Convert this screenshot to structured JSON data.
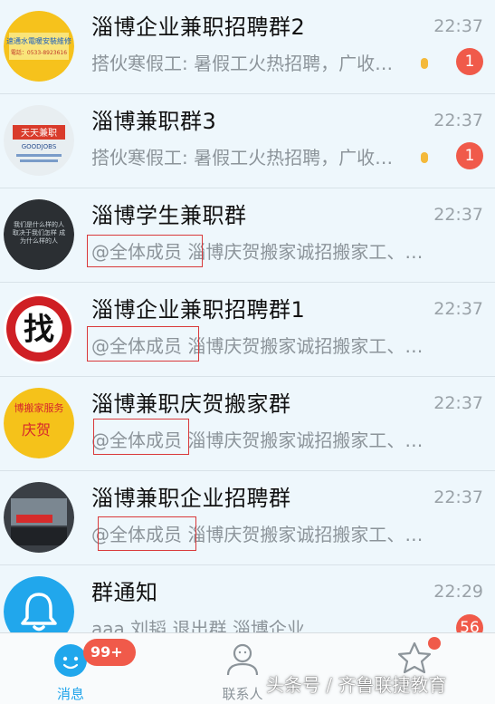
{
  "chats": [
    {
      "name": "淄博企业兼职招聘群2",
      "time": "22:37",
      "preview": "搭伙寒假工: 暑假工火热招聘，广收…",
      "badge": "1"
    },
    {
      "name": "淄博兼职群3",
      "time": "22:37",
      "preview": "搭伙寒假工: 暑假工火热招聘，广收…",
      "badge": "1"
    },
    {
      "name": "淄博学生兼职群",
      "time": "22:37",
      "mention": "@全体成员",
      "preview": "淄博庆贺搬家诚招搬家工、…"
    },
    {
      "name": "淄博企业兼职招聘群1",
      "time": "22:37",
      "mention": "@全体成员",
      "preview": "淄博庆贺搬家诚招搬家工、…"
    },
    {
      "name": "淄博兼职庆贺搬家群",
      "time": "22:37",
      "mention": "@全体成员",
      "preview": "淄博庆贺搬家诚招搬家工、…"
    },
    {
      "name": "淄博兼职企业招聘群",
      "time": "22:37",
      "mention": "@全体成员",
      "preview": "淄博庆贺搬家诚招搬家工、…"
    },
    {
      "name": "群通知",
      "time": "22:29",
      "preview": "aaa 刘韬 退出群 淄博企业...",
      "badge": "56"
    }
  ],
  "avatars": {
    "a1_line1": "速通水電暖安裝維修",
    "a1_line2": "電話：0533-8923616",
    "a2_title": "天天兼职",
    "a2_sub": "GOODJOBS",
    "a3_text": "我们是什么样的人 取决于我们怎样 成为什么样的人",
    "a4_char": "找",
    "a5_top": "博搬家服务",
    "a5_char": "庆贺"
  },
  "tabbar": {
    "messages_label": "消息",
    "contacts_label": "联系人",
    "messages_unread": "99+"
  },
  "watermark": "头条号 / 齐鲁联捷教育",
  "colors": {
    "accent": "#1ea3ea",
    "badge": "#f05a4a",
    "mention_box": "#d9393b"
  }
}
